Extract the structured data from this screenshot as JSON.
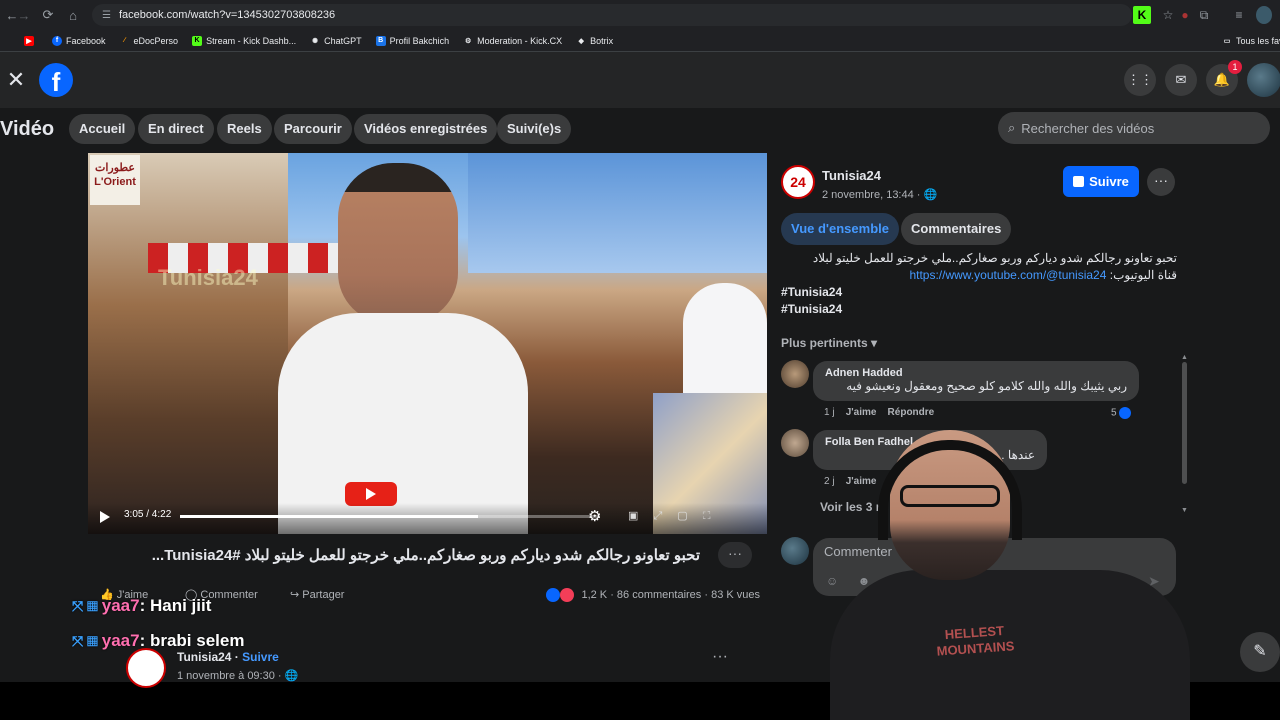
{
  "browser": {
    "url": "facebook.com/watch?v=1345302703808236",
    "bookmarks": [
      "Facebook",
      "eDocPerso",
      "Stream - Kick Dashb...",
      "ChatGPT",
      "Profil Bakchich",
      "Moderation - Kick.CX",
      "Botrix"
    ],
    "all_bookmarks": "Tous les fav"
  },
  "fb": {
    "notif_count": "1",
    "section_title": "Vidéo",
    "nav": [
      "Accueil",
      "En direct",
      "Reels",
      "Parcourir",
      "Vidéos enregistrées",
      "Suivi(e)s"
    ],
    "search_placeholder": "Rechercher des vidéos"
  },
  "video": {
    "time": "3:05 / 4:22",
    "progress": 0.71,
    "shop_sign": "عطورات L'Orient",
    "watermark": "Tunisia24",
    "caption": "تحبو تعاونو رجالكم شدو دياركم وربو صغاركم..ملي خرجتو للعمل خليتو لبلاد #Tunisia24...",
    "like": "J'aime",
    "comment": "Commenter",
    "share": "Partager",
    "reactions": "1,2 K",
    "comments_count": "86 commentaires",
    "views": "83 K vues"
  },
  "panel": {
    "page_name": "Tunisia24",
    "date": "2 novembre, 13:44 · 🌐",
    "follow": "Suivre",
    "tabs": [
      "Vue d'ensemble",
      "Commentaires"
    ],
    "desc_line1": "تحبو تعاونو رجالكم شدو دياركم وربو صغاركم..ملي خرجتو للعمل خليتو لبلاد",
    "desc_link": "https://www.youtube.com/@tunisia24",
    "desc_label": ":قناة اليوتيوب",
    "hashtags": [
      "#Tunisia24",
      "#Tunisia24"
    ],
    "sort": "Plus pertinents",
    "comments": [
      {
        "name": "Adnen Hadded",
        "text": "ربي يثيبك والله والله كلامو كلو صحيح ومعقول ونعيشو فيه",
        "age": "1 j",
        "like": "J'aime",
        "reply": "Répondre",
        "likes": "5"
      },
      {
        "name": "Folla Ben Fadhel",
        "text": "عندها ... شي بي الارتنات",
        "age": "2 j",
        "like": "J'aime"
      }
    ],
    "see_replies": "Voir les 3 ré",
    "comment_placeholder": "Commenter"
  },
  "chat": [
    {
      "user": "yaa7",
      "msg": ": Hani jiit"
    },
    {
      "user": "yaa7",
      "msg": ": brabi selem"
    }
  ],
  "next_post": {
    "name": "Tunisia24",
    "follow": "Suivre",
    "date": "1 novembre à 09:30 · 🌐"
  },
  "streamer_shirt": "HELLEST MOUNTAINS"
}
